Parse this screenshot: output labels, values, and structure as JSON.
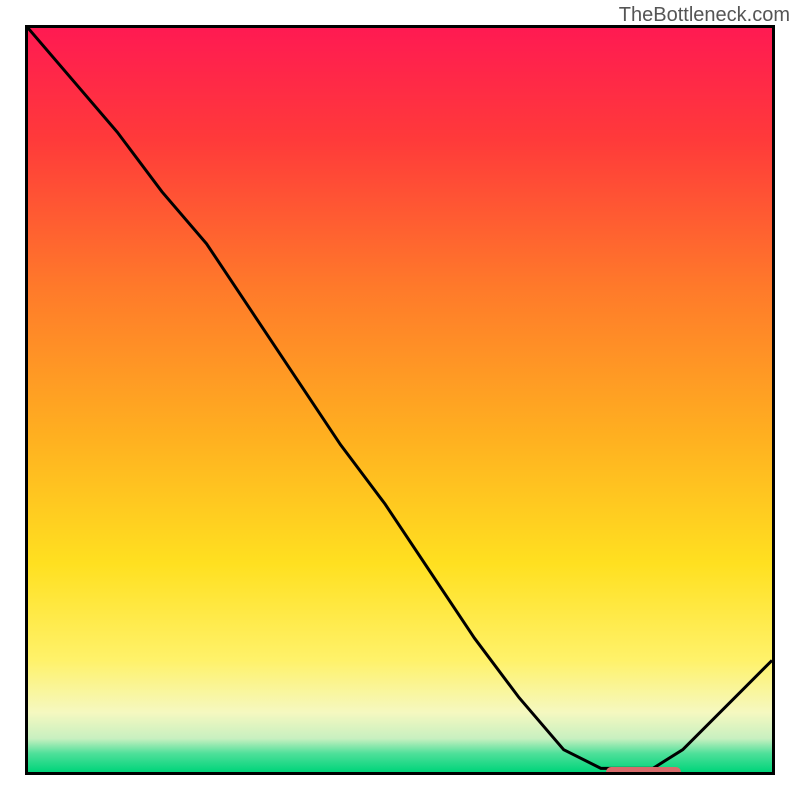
{
  "watermark": "TheBottleneck.com",
  "chart_data": {
    "type": "line",
    "title": "",
    "xlabel": "",
    "ylabel": "",
    "xlim": [
      0,
      1
    ],
    "ylim": [
      0,
      1
    ],
    "series": [
      {
        "name": "curve",
        "x": [
          0.0,
          0.06,
          0.12,
          0.18,
          0.24,
          0.3,
          0.36,
          0.42,
          0.48,
          0.54,
          0.6,
          0.66,
          0.72,
          0.77,
          0.8,
          0.84,
          0.88,
          0.92,
          0.96,
          1.0
        ],
        "y": [
          1.0,
          0.93,
          0.86,
          0.78,
          0.71,
          0.62,
          0.53,
          0.44,
          0.36,
          0.27,
          0.18,
          0.1,
          0.03,
          0.005,
          0.005,
          0.005,
          0.03,
          0.07,
          0.11,
          0.15
        ]
      }
    ],
    "gradient_stops": [
      {
        "offset": 0.0,
        "color": "#ff1a52"
      },
      {
        "offset": 0.15,
        "color": "#ff3a3a"
      },
      {
        "offset": 0.35,
        "color": "#ff7a2a"
      },
      {
        "offset": 0.55,
        "color": "#ffb020"
      },
      {
        "offset": 0.72,
        "color": "#ffe020"
      },
      {
        "offset": 0.85,
        "color": "#fff26a"
      },
      {
        "offset": 0.92,
        "color": "#f5f8c0"
      },
      {
        "offset": 0.955,
        "color": "#c8f0c0"
      },
      {
        "offset": 0.975,
        "color": "#4fe09a"
      },
      {
        "offset": 1.0,
        "color": "#00d47a"
      }
    ],
    "marker": {
      "x_start": 0.77,
      "x_end": 0.87,
      "y": 0.008,
      "color": "#d86b6b"
    }
  }
}
